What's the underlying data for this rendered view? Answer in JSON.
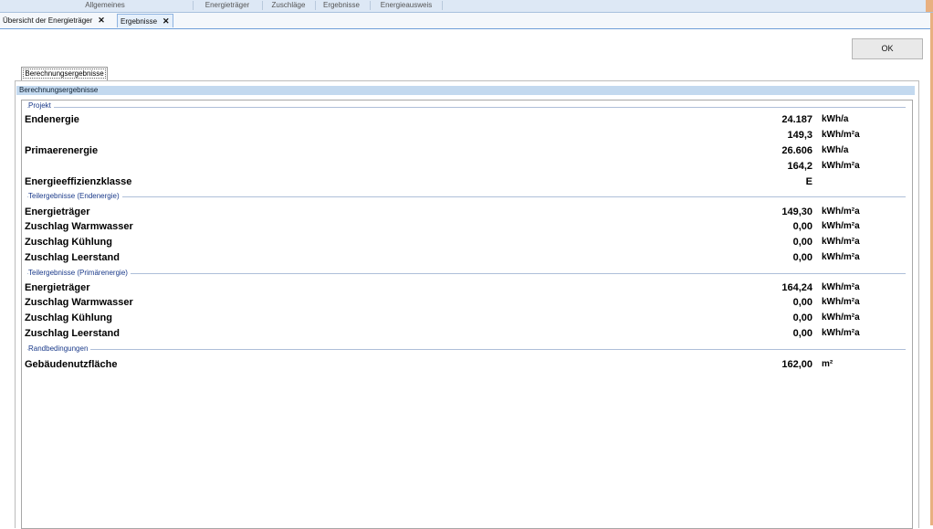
{
  "ribbon": {
    "groups": [
      "Allgemeines",
      "Energieträger",
      "Zuschläge",
      "Ergebnisse",
      "Energieausweis"
    ]
  },
  "doc_tabs": [
    {
      "label": "Übersicht der Energieträger",
      "close": "✕"
    },
    {
      "label": "Ergebnisse",
      "close": "✕"
    }
  ],
  "ok_label": "OK",
  "inner_tab": "Berechnungsergebnisse",
  "section_title": "Berechnungsergebnisse",
  "groups": {
    "projekt": "Projekt",
    "teil_end": "Teilergebnisse (Endenergie)",
    "teil_prim": "Teilergebnisse (Primärenergie)",
    "rand": "Randbedingungen"
  },
  "rows": {
    "endenergie": {
      "label": "Endenergie",
      "value1": "24.187",
      "unit1": "kWh/a",
      "value2": "149,3",
      "unit2": "kWh/m²a"
    },
    "primaerenergie": {
      "label": "Primaerenergie",
      "value1": "26.606",
      "unit1": "kWh/a",
      "value2": "164,2",
      "unit2": "kWh/m²a"
    },
    "effizienz": {
      "label": "Energieeffizienzklasse",
      "value": "E"
    },
    "end_items": [
      {
        "label": "Energieträger",
        "value": "149,30",
        "unit": "kWh/m²a"
      },
      {
        "label": "Zuschlag Warmwasser",
        "value": "0,00",
        "unit": "kWh/m²a"
      },
      {
        "label": "Zuschlag Kühlung",
        "value": "0,00",
        "unit": "kWh/m²a"
      },
      {
        "label": "Zuschlag Leerstand",
        "value": "0,00",
        "unit": "kWh/m²a"
      }
    ],
    "prim_items": [
      {
        "label": "Energieträger",
        "value": "164,24",
        "unit": "kWh/m²a"
      },
      {
        "label": "Zuschlag Warmwasser",
        "value": "0,00",
        "unit": "kWh/m²a"
      },
      {
        "label": "Zuschlag Kühlung",
        "value": "0,00",
        "unit": "kWh/m²a"
      },
      {
        "label": "Zuschlag Leerstand",
        "value": "0,00",
        "unit": "kWh/m²a"
      }
    ],
    "flaeche": {
      "label": "Gebäudenutzfläche",
      "value": "162,00",
      "unit": "m²"
    }
  }
}
